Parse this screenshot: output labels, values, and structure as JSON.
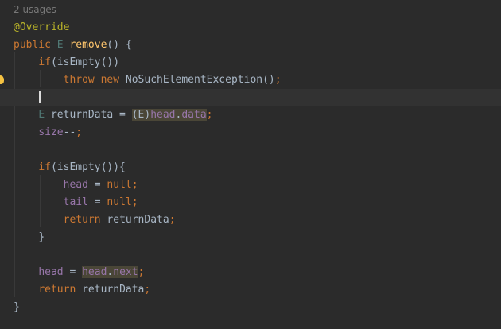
{
  "editor": {
    "usages_hint": "2 usages",
    "lines": [
      [
        {
          "t": "@Override",
          "c": "ann"
        }
      ],
      [
        {
          "t": "public ",
          "c": "kw"
        },
        {
          "t": "E ",
          "c": "tp"
        },
        {
          "t": "remove",
          "c": "fn"
        },
        {
          "t": "() {",
          "c": "pl"
        }
      ],
      [
        {
          "t": "    "
        },
        {
          "t": "if",
          "c": "kw"
        },
        {
          "t": "(isEmpty())",
          "c": "pl"
        }
      ],
      [
        {
          "t": "        "
        },
        {
          "t": "throw new ",
          "c": "kw"
        },
        {
          "t": "NoSuchElementException()",
          "c": "pl"
        },
        {
          "t": ";",
          "c": "kw"
        }
      ],
      [
        {
          "t": ""
        }
      ],
      [
        {
          "t": "    "
        },
        {
          "t": "E ",
          "c": "tp"
        },
        {
          "t": "returnData = ",
          "c": "pl"
        },
        {
          "t": "(E)",
          "c": "pl",
          "hl": true,
          "cast": true
        },
        {
          "t": "head",
          "c": "fld",
          "hl": true
        },
        {
          "t": ".",
          "c": "pl",
          "hl": true
        },
        {
          "t": "data",
          "c": "fld",
          "hl": true
        },
        {
          "t": ";",
          "c": "kw"
        }
      ],
      [
        {
          "t": "    "
        },
        {
          "t": "size",
          "c": "fld"
        },
        {
          "t": "--",
          "c": "pl"
        },
        {
          "t": ";",
          "c": "kw"
        }
      ],
      [
        {
          "t": ""
        }
      ],
      [
        {
          "t": "    "
        },
        {
          "t": "if",
          "c": "kw"
        },
        {
          "t": "(isEmpty()){",
          "c": "pl"
        }
      ],
      [
        {
          "t": "        "
        },
        {
          "t": "head",
          "c": "fld"
        },
        {
          "t": " = ",
          "c": "pl"
        },
        {
          "t": "null",
          "c": "kw"
        },
        {
          "t": ";",
          "c": "kw"
        }
      ],
      [
        {
          "t": "        "
        },
        {
          "t": "tail",
          "c": "fld"
        },
        {
          "t": " = ",
          "c": "pl"
        },
        {
          "t": "null",
          "c": "kw"
        },
        {
          "t": ";",
          "c": "kw"
        }
      ],
      [
        {
          "t": "        "
        },
        {
          "t": "return ",
          "c": "kw"
        },
        {
          "t": "returnData",
          "c": "pl"
        },
        {
          "t": ";",
          "c": "kw"
        }
      ],
      [
        {
          "t": "    "
        },
        {
          "t": "}",
          "c": "pl"
        }
      ],
      [
        {
          "t": ""
        }
      ],
      [
        {
          "t": "    "
        },
        {
          "t": "head",
          "c": "fld"
        },
        {
          "t": " = ",
          "c": "pl"
        },
        {
          "t": "head",
          "c": "fld",
          "hl": true
        },
        {
          "t": ".",
          "c": "pl",
          "hl": true
        },
        {
          "t": "next",
          "c": "fld",
          "hl": true
        },
        {
          "t": ";",
          "c": "kw"
        }
      ],
      [
        {
          "t": "    "
        },
        {
          "t": "return ",
          "c": "kw"
        },
        {
          "t": "returnData",
          "c": "pl"
        },
        {
          "t": ";",
          "c": "kw"
        }
      ],
      [
        {
          "t": "}",
          "c": "pl"
        }
      ]
    ],
    "current_line": 4,
    "colors": {
      "background": "#2b2b2b",
      "keyword": "#cc7832",
      "annotation": "#bbb529",
      "method": "#ffc66d",
      "field": "#9876aa",
      "type_param": "#507874",
      "plain": "#a9b7c6",
      "highlight": "#4a4637"
    },
    "gutter_icon": "intention-bulb-icon"
  }
}
